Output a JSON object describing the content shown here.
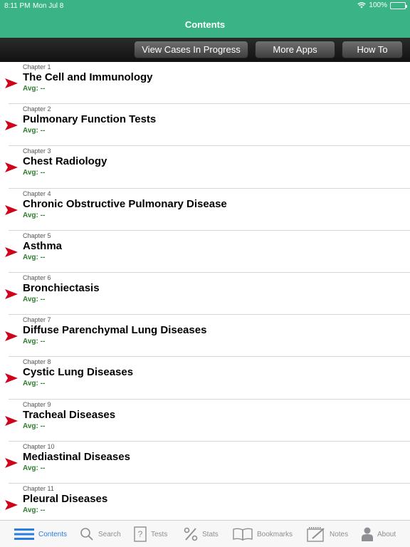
{
  "status_bar": {
    "time": "8:11 PM",
    "date": "Mon Jul 8",
    "battery": "100%"
  },
  "nav": {
    "title": "Contents"
  },
  "toolbar": {
    "view_cases": "View Cases In Progress",
    "more_apps": "More Apps",
    "how_to": "How To"
  },
  "chapters": [
    {
      "chapter": "Chapter 1",
      "title": "The Cell and Immunology",
      "avg": "Avg: --"
    },
    {
      "chapter": "Chapter 2",
      "title": "Pulmonary Function Tests",
      "avg": "Avg: --"
    },
    {
      "chapter": "Chapter 3",
      "title": "Chest Radiology",
      "avg": "Avg: --"
    },
    {
      "chapter": "Chapter 4",
      "title": "Chronic Obstructive Pulmonary Disease",
      "avg": "Avg: --"
    },
    {
      "chapter": "Chapter 5",
      "title": "Asthma",
      "avg": "Avg: --"
    },
    {
      "chapter": "Chapter 6",
      "title": "Bronchiectasis",
      "avg": "Avg: --"
    },
    {
      "chapter": "Chapter 7",
      "title": "Diffuse Parenchymal Lung Diseases",
      "avg": "Avg: --"
    },
    {
      "chapter": "Chapter 8",
      "title": "Cystic Lung Diseases",
      "avg": "Avg: --"
    },
    {
      "chapter": "Chapter 9",
      "title": "Tracheal Diseases",
      "avg": "Avg: --"
    },
    {
      "chapter": "Chapter 10",
      "title": "Mediastinal Diseases",
      "avg": "Avg: --"
    },
    {
      "chapter": "Chapter 11",
      "title": "Pleural Diseases",
      "avg": "Avg: --"
    }
  ],
  "tabs": [
    {
      "label": "Contents",
      "icon": "list-icon"
    },
    {
      "label": "Search",
      "icon": "search-icon"
    },
    {
      "label": "Tests",
      "icon": "question-icon"
    },
    {
      "label": "Stats",
      "icon": "percent-icon"
    },
    {
      "label": "Bookmarks",
      "icon": "book-icon"
    },
    {
      "label": "Notes",
      "icon": "notes-icon"
    },
    {
      "label": "About",
      "icon": "person-icon"
    }
  ],
  "colors": {
    "nav_bg": "#3ab487",
    "arrow": "#d0021b",
    "avg_text": "#2f7d2f",
    "active_tab": "#2a7de1"
  }
}
